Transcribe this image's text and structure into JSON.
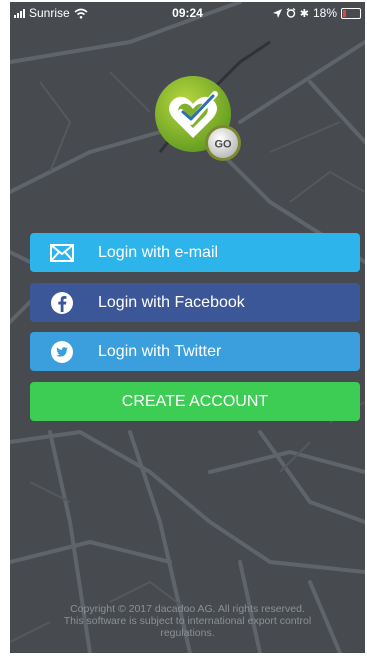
{
  "status_bar": {
    "carrier": "Sunrise",
    "time": "09:24",
    "battery": "18%",
    "battery_level": 0.18,
    "battery_color": "#e8413a"
  },
  "logo": {
    "badge_text": "GO"
  },
  "buttons": {
    "email": {
      "label": "Login with e-mail",
      "icon": "envelope-icon",
      "color": "#2db4ea"
    },
    "facebook": {
      "label": "Login with Facebook",
      "icon": "facebook-icon",
      "color": "#3c5798"
    },
    "twitter": {
      "label": "Login with Twitter",
      "icon": "twitter-icon",
      "color": "#3a9fdc"
    },
    "create": {
      "label": "CREATE ACCOUNT",
      "color": "#3dcc54"
    }
  },
  "footer": {
    "line1": "Copyright © 2017 dacadoo AG. All rights reserved.",
    "line2": "This software is subject to international export control",
    "line3": "regulations."
  }
}
